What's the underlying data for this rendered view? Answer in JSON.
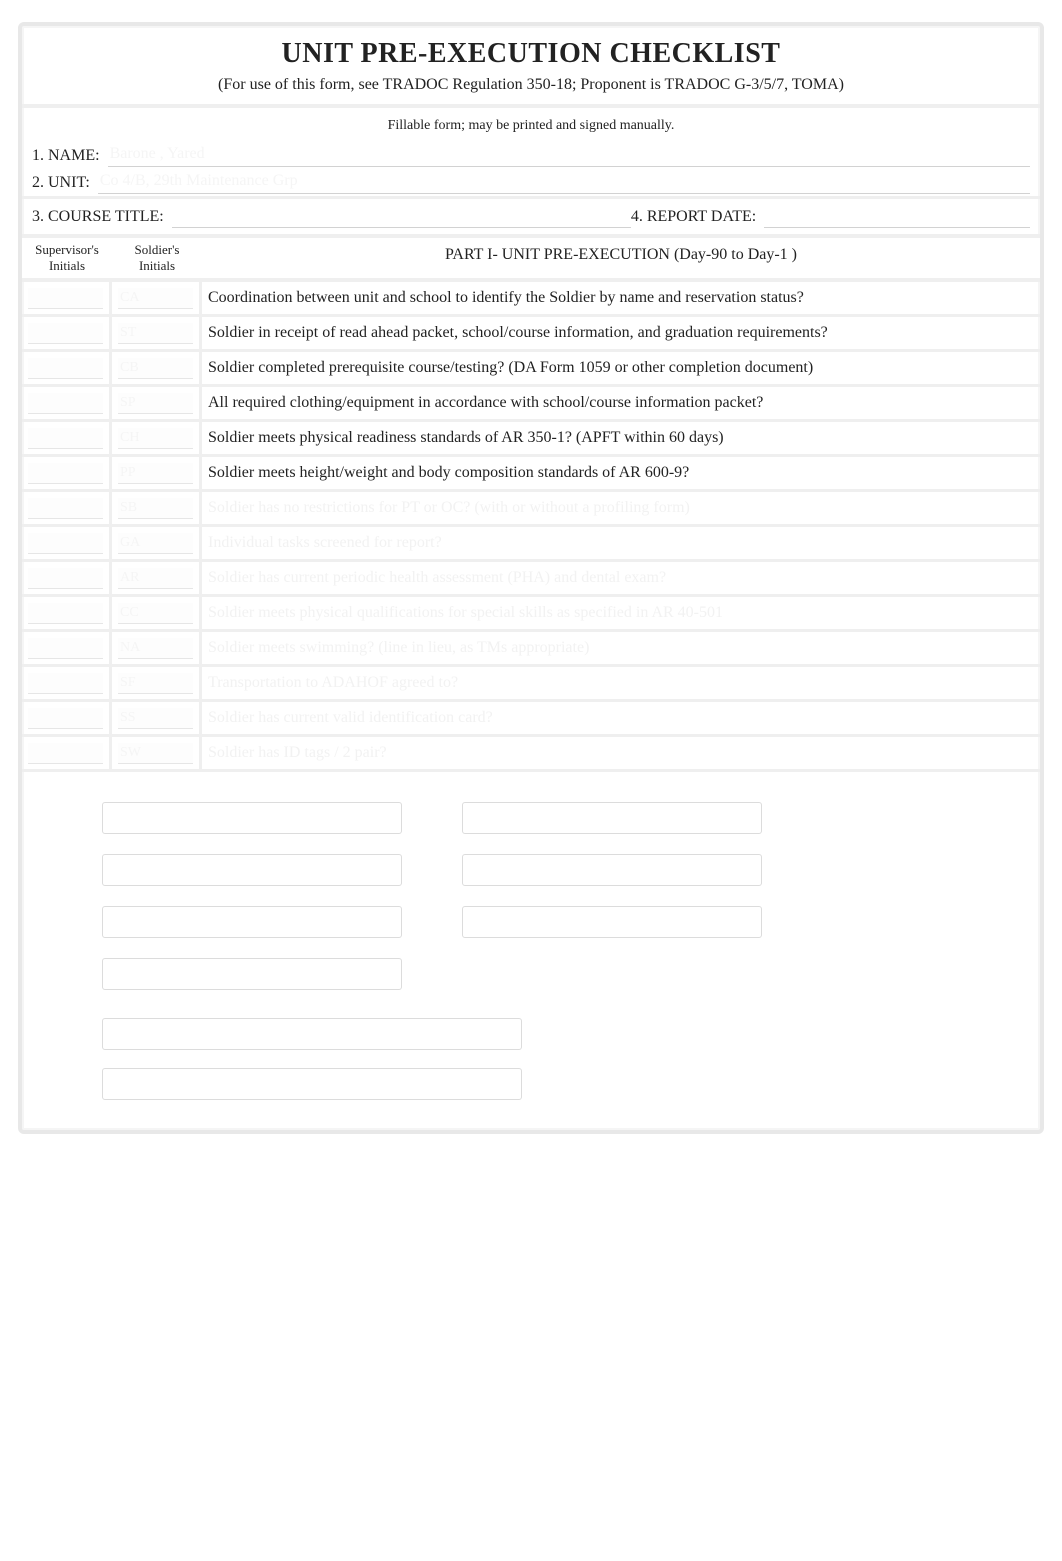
{
  "header": {
    "title": "UNIT PRE-EXECUTION CHECKLIST",
    "subtitle": "(For use of this form, see TRADOC Regulation 350-18; Proponent is TRADOC G-3/5/7, TOMA)",
    "fillable_note": "Fillable form; may be printed and signed manually."
  },
  "fields": {
    "name_label": "1. NAME:",
    "name_value": "Barone , Yared",
    "unit_label": "2. UNIT:",
    "unit_value": "Co 4/B, 29th Maintenance Grp",
    "course_label": "3. COURSE TITLE:",
    "course_value": "",
    "report_label": "4. REPORT DATE:",
    "report_value": ""
  },
  "columns": {
    "supervisor": "Supervisor's Initials",
    "soldier": "Soldier's Initials",
    "section_title": "PART I- UNIT PRE-EXECUTION (Day-90 to Day-1     )"
  },
  "items": [
    {
      "sup": "",
      "sol": "CA",
      "text": "Coordination between unit and school to identify the Soldier by name and reservation status?",
      "masked": false
    },
    {
      "sup": "",
      "sol": "ST",
      "text": "Soldier in receipt of read ahead packet, school/course information, and graduation requirements?",
      "masked": false
    },
    {
      "sup": "",
      "sol": "CB",
      "text": "Soldier completed prerequisite course/testing? (DA Form 1059 or other completion document)",
      "masked": false
    },
    {
      "sup": "",
      "sol": "SP",
      "text": "All required clothing/equipment in accordance with school/course information packet?",
      "masked": false
    },
    {
      "sup": "",
      "sol": "CH",
      "text": "Soldier meets physical readiness standards of AR 350-1? (APFT within 60 days)",
      "masked": false
    },
    {
      "sup": "",
      "sol": "PP",
      "text": "Soldier meets height/weight and body composition standards of AR 600-9?",
      "masked": false
    },
    {
      "sup": "",
      "sol": "SB",
      "text": "Soldier has no restrictions for PT or OC? (with or without a profiling form)",
      "masked": true
    },
    {
      "sup": "",
      "sol": "GA",
      "text": "Individual tasks screened for report?",
      "masked": true
    },
    {
      "sup": "",
      "sol": "AR",
      "text": "Soldier has current periodic health assessment (PHA) and dental exam?",
      "masked": true
    },
    {
      "sup": "",
      "sol": "CC",
      "text": "Soldier meets physical qualifications for special skills as specified in AR 40-501",
      "masked": true
    },
    {
      "sup": "",
      "sol": "NA",
      "text": "Soldier meets swimming? (line in lieu, as TMs appropriate)",
      "masked": true
    },
    {
      "sup": "",
      "sol": "SF",
      "text": "Transportation to ADAHOF agreed to?",
      "masked": true
    },
    {
      "sup": "",
      "sol": "SS",
      "text": "Soldier has current valid identification card?",
      "masked": true
    },
    {
      "sup": "",
      "sol": "SW",
      "text": "Soldier has ID tags / 2 pair?",
      "masked": true
    }
  ],
  "signatures": {
    "left": [
      "",
      "",
      "",
      ""
    ],
    "right": [
      "",
      "",
      ""
    ],
    "bottom": [
      "",
      ""
    ]
  }
}
